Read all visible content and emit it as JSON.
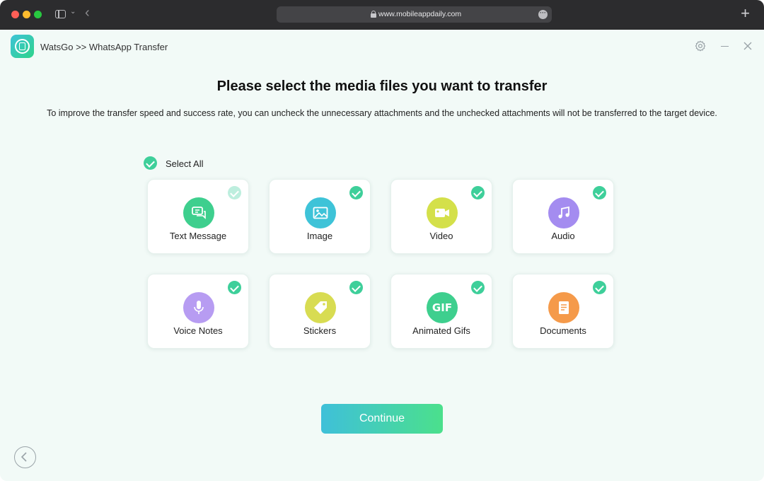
{
  "browser": {
    "url": "www.mobileappdaily.com",
    "new_tab_glyph": "+",
    "back_glyph": "‹"
  },
  "app": {
    "title": "WatsGo >> WhatsApp Transfer"
  },
  "main": {
    "title": "Please select the media files you want to transfer",
    "description": "To improve the transfer speed and success rate, you can uncheck the unnecessary attachments and the unchecked attachments will not be transferred to the target device.",
    "select_all_label": "Select All",
    "continue_label": "Continue"
  },
  "items": [
    {
      "label": "Text Message",
      "icon": "chat-bubbles-icon",
      "color": "#3ecf8e",
      "checked": true
    },
    {
      "label": "Image",
      "icon": "picture-icon",
      "color": "#3ec3d8",
      "checked": true
    },
    {
      "label": "Video",
      "icon": "video-camera-icon",
      "color": "#d4e04a",
      "checked": true
    },
    {
      "label": "Audio",
      "icon": "music-note-icon",
      "color": "#a48cf0",
      "checked": true
    },
    {
      "label": "Voice Notes",
      "icon": "microphone-icon",
      "color": "#b79cf2",
      "checked": true
    },
    {
      "label": "Stickers",
      "icon": "tag-icon",
      "color": "#d8dc52",
      "checked": true
    },
    {
      "label": "Animated Gifs",
      "icon": "gif-icon",
      "color": "#3ecf8e",
      "checked": true,
      "icon_text": "GIF"
    },
    {
      "label": "Documents",
      "icon": "document-icon",
      "color": "#f59a4a",
      "checked": true
    }
  ],
  "colors": {
    "accent": "#3ecf9a",
    "background": "#f2faf7"
  }
}
